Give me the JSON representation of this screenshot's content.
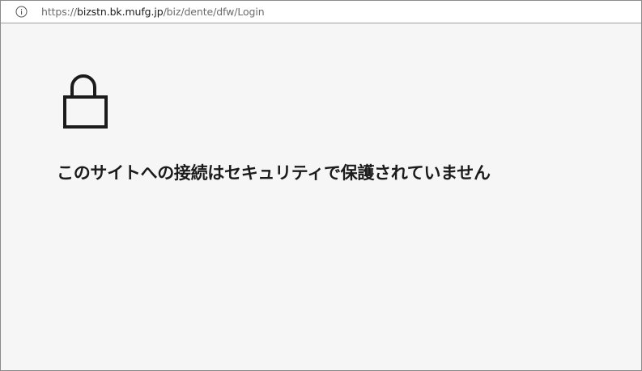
{
  "address_bar": {
    "icon": "info-icon",
    "url_scheme": "https://",
    "url_host": "bizstn.bk.mufg.jp",
    "url_path": "/biz/dente/dfw/Login"
  },
  "page": {
    "icon": "unlocked-padlock-icon",
    "heading": "このサイトへの接続はセキュリティで保護されていません"
  },
  "colors": {
    "page_background": "#f6f6f6",
    "text": "#1b1b1b",
    "url_muted": "#6b6b6b"
  }
}
